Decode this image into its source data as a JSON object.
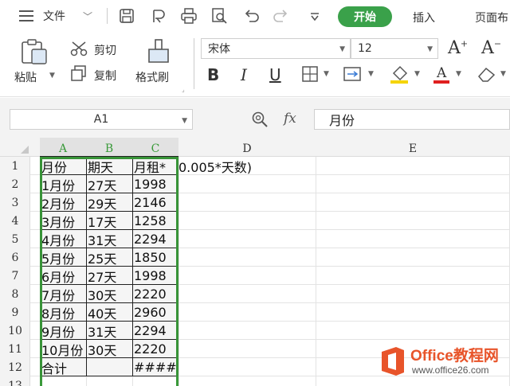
{
  "menubar": {
    "file_label": "文件",
    "tabs": {
      "start": "开始",
      "insert": "插入",
      "page": "页面布"
    }
  },
  "ribbon": {
    "paste": "粘贴",
    "cut": "剪切",
    "copy": "复制",
    "format_painter": "格式刷",
    "font_name": "宋体",
    "font_size": "12",
    "bold": "B",
    "italic": "I",
    "underline": "U"
  },
  "formula_bar": {
    "name_box": "A1",
    "fx": "fx",
    "formula": "月份"
  },
  "columns": [
    "A",
    "B",
    "C",
    "D",
    "E"
  ],
  "rows": [
    "1",
    "2",
    "3",
    "4",
    "5",
    "6",
    "7",
    "8",
    "9",
    "10",
    "11",
    "12",
    "13"
  ],
  "cells": [
    {
      "a": "月份",
      "b": "期天",
      "c": "月租*",
      "d": "0.005*天数)"
    },
    {
      "a": "1月份",
      "b": "27天",
      "c": "1998"
    },
    {
      "a": "2月份",
      "b": "29天",
      "c": "2146"
    },
    {
      "a": "3月份",
      "b": "17天",
      "c": "1258"
    },
    {
      "a": "4月份",
      "b": "31天",
      "c": "2294"
    },
    {
      "a": "5月份",
      "b": "25天",
      "c": "1850"
    },
    {
      "a": "6月份",
      "b": "27天",
      "c": "1998"
    },
    {
      "a": "7月份",
      "b": "30天",
      "c": "2220"
    },
    {
      "a": "8月份",
      "b": "40天",
      "c": "2960"
    },
    {
      "a": "9月份",
      "b": "31天",
      "c": "2294"
    },
    {
      "a": "10月份",
      "b": "30天",
      "c": "2220"
    },
    {
      "a": "合计",
      "b": "",
      "c": "####"
    }
  ],
  "watermark": {
    "brand": "Office教程网",
    "url": "www.office26.com"
  },
  "colors": {
    "accent_green": "#3aa14a",
    "selection_green": "#3a9a3a",
    "logo_orange": "#e8542a"
  }
}
